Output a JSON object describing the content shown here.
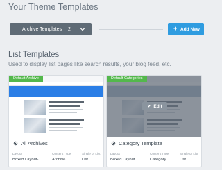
{
  "header": {
    "title": "Your Theme Templates"
  },
  "filter": {
    "label": "Archive Templates",
    "count": "2"
  },
  "add_button": {
    "label": "Add New"
  },
  "section": {
    "title": "List Templates",
    "description": "Used to display list pages like search results, your blog feed, etc."
  },
  "cards": [
    {
      "badge": "Default Archive",
      "name": "All Archives",
      "meta": [
        {
          "label": "Layout",
          "value": "Boxed Layout-..."
        },
        {
          "label": "Content Type",
          "value": "Archive"
        },
        {
          "label": "Single or List",
          "value": "List"
        }
      ]
    },
    {
      "badge": "Default Categories",
      "name": "Category Template",
      "edit_label": "Edit",
      "meta": [
        {
          "label": "Layout",
          "value": "Boxed Layout"
        },
        {
          "label": "Content Type",
          "value": "Category"
        },
        {
          "label": "Single or List",
          "value": "List"
        }
      ]
    }
  ],
  "colors": {
    "accent": "#2f9ce0",
    "badge": "#54b84c",
    "dropdown": "#5f6b76"
  },
  "icons": {
    "dropdown": "chevron-down-icon",
    "add": "plus-icon",
    "edit": "pencil-icon",
    "card": "gear-icon"
  }
}
